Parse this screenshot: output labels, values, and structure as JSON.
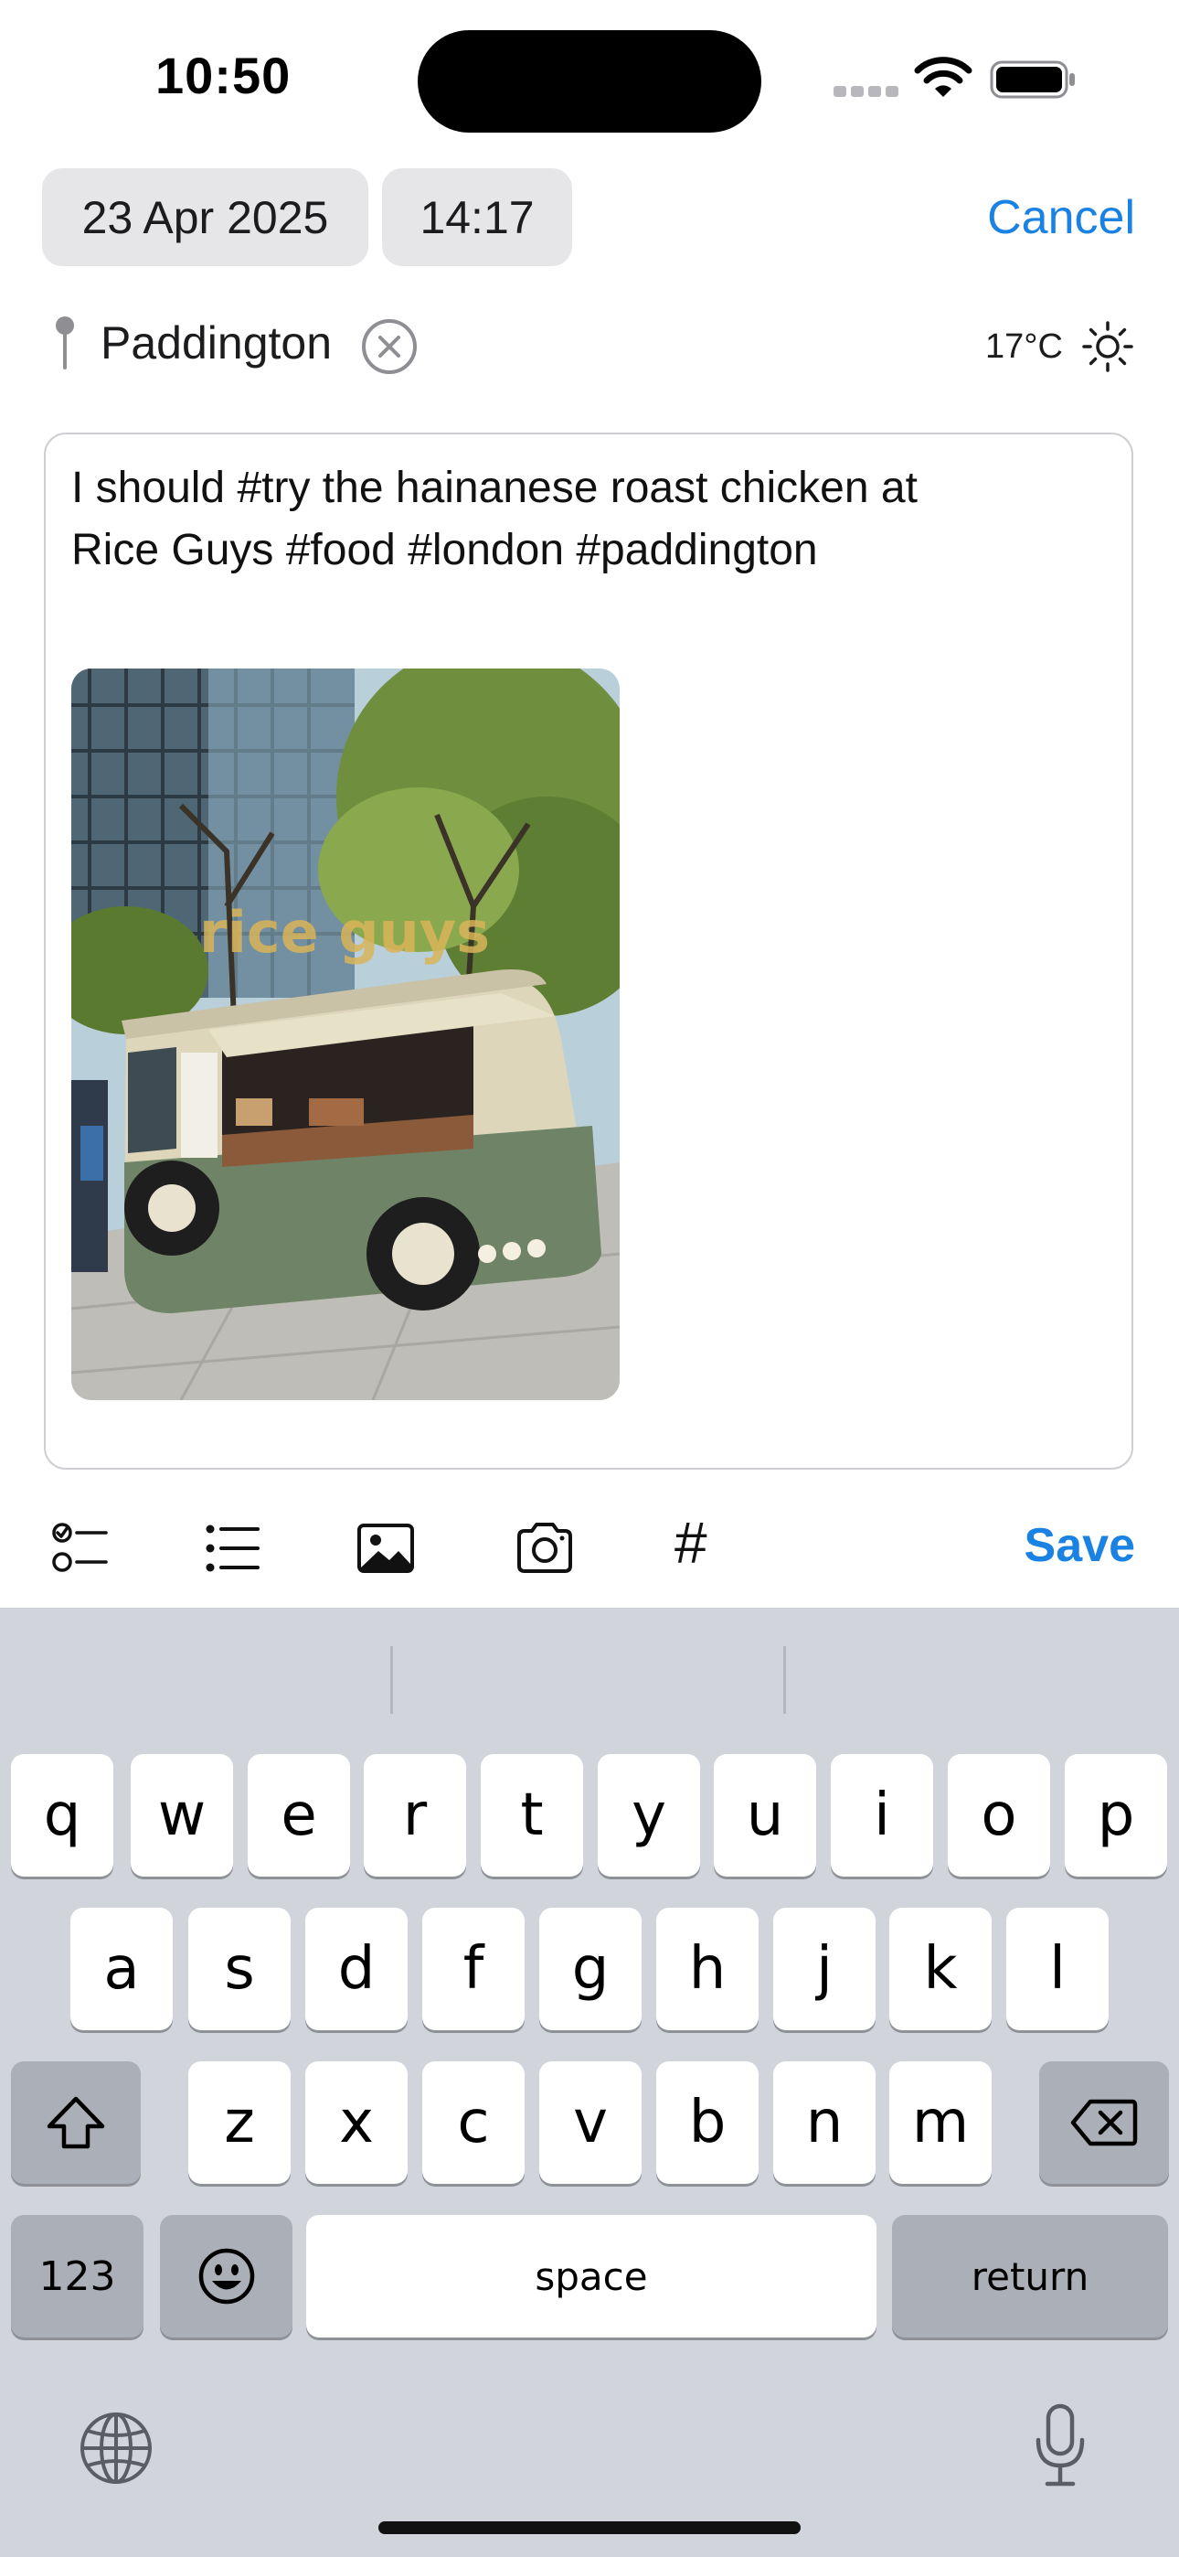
{
  "status_bar": {
    "time": "10:50"
  },
  "header": {
    "date": "23 Apr 2025",
    "time": "14:17",
    "cancel_label": "Cancel"
  },
  "location": {
    "place": "Paddington",
    "temperature": "17°C"
  },
  "note": {
    "text": "I should #try the hainanese roast chicken at\nRice Guys #food #london #paddington",
    "photo_sign_text": "rice guys"
  },
  "toolbar": {
    "items": [
      "checklist-icon",
      "bullet-list-icon",
      "photo-library-icon",
      "camera-icon",
      "hashtag-icon"
    ],
    "hashtag_glyph": "#",
    "save_label": "Save"
  },
  "keyboard": {
    "row1": [
      "q",
      "w",
      "e",
      "r",
      "t",
      "y",
      "u",
      "i",
      "o",
      "p"
    ],
    "row2": [
      "a",
      "s",
      "d",
      "f",
      "g",
      "h",
      "j",
      "k",
      "l"
    ],
    "row3": [
      "z",
      "x",
      "c",
      "v",
      "b",
      "n",
      "m"
    ],
    "numbers_label": "123",
    "space_label": "space",
    "return_label": "return"
  },
  "colors": {
    "accent": "#1a82e2",
    "keyboard_bg": "#d1d4da",
    "key_bg": "#ffffff",
    "key_dark_bg": "#abafb7"
  }
}
